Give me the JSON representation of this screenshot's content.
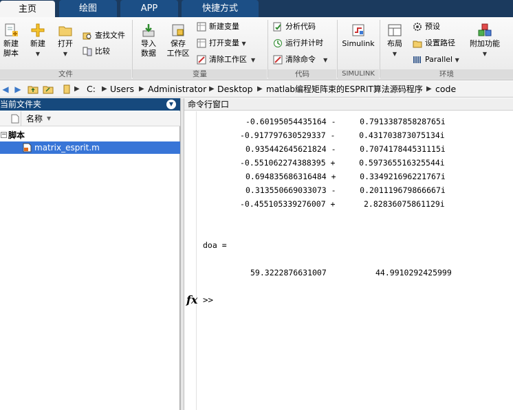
{
  "tabs": [
    {
      "label": "主页",
      "active": true
    },
    {
      "label": "绘图",
      "active": false
    },
    {
      "label": "APP",
      "active": false
    },
    {
      "label": "快捷方式",
      "active": false
    }
  ],
  "ribbon": {
    "file": {
      "group_label": "文件",
      "new_script": "新建\n脚本",
      "new": "新建",
      "open": "打开",
      "find_files": "查找文件",
      "compare": "比较"
    },
    "variable": {
      "group_label": "变量",
      "import_data": "导入\n数据",
      "save_workspace": "保存\n工作区",
      "new_variable": "新建变量",
      "open_variable": "打开变量",
      "clear_workspace": "清除工作区"
    },
    "code": {
      "group_label": "代码",
      "analyze_code": "分析代码",
      "run_and_time": "运行并计时",
      "clear_commands": "清除命令"
    },
    "simulink": {
      "group_label": "SIMULINK",
      "simulink": "Simulink"
    },
    "environment": {
      "group_label": "环境",
      "layout": "布局",
      "preferences": "预设",
      "set_path": "设置路径",
      "parallel": "Parallel",
      "addons": "附加功能"
    }
  },
  "address": {
    "crumbs": [
      "C:",
      "Users",
      "Administrator",
      "Desktop",
      "matlab编程矩阵束的ESPRIT算法源码程序",
      "code"
    ]
  },
  "current_folder": {
    "title": "当前文件夹",
    "column_name": "名称",
    "group": "脚本",
    "files": [
      "matrix_esprit.m"
    ]
  },
  "command_window": {
    "title": "命令行窗口",
    "output_lines": [
      "-0.60195054435164 -     0.791338785828765i",
      "-0.917797630529337 -     0.431703873075134i",
      "0.935442645621824 -     0.707417844531115i",
      "-0.551062274388395 +     0.597365516325544i",
      "0.694835686316484 +     0.334921696221767i",
      "0.313550669033073 -     0.201119679866667i",
      "-0.455105339276007 +      2.82836075861129i"
    ],
    "doa_label": "doa =",
    "doa_values": [
      "59.3222876631007",
      "44.9910292425999"
    ],
    "prompt": ">>",
    "fx_symbol": "fx"
  }
}
